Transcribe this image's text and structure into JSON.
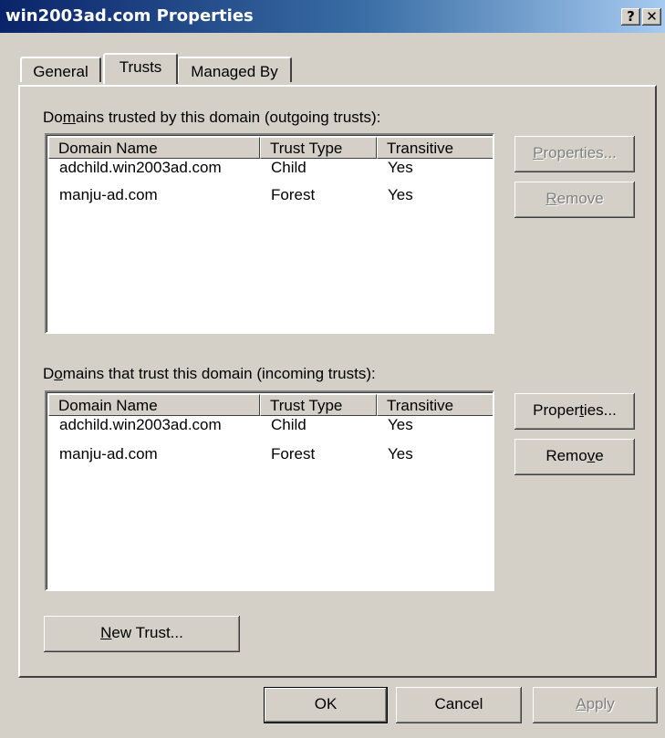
{
  "window": {
    "title": "win2003ad.com Properties",
    "help_button": "?",
    "close_button": "✕"
  },
  "tabs": [
    {
      "label": "General"
    },
    {
      "label": "Trusts"
    },
    {
      "label": "Managed By"
    }
  ],
  "outgoing": {
    "label_pre": "Do",
    "label_accel": "m",
    "label_post": "ains trusted by this domain (outgoing trusts):",
    "columns": [
      "Domain Name",
      "Trust Type",
      "Transitive"
    ],
    "rows": [
      [
        "adchild.win2003ad.com",
        "Child",
        "Yes"
      ],
      [
        "manju-ad.com",
        "Forest",
        "Yes"
      ]
    ],
    "properties_button": {
      "accel": "P",
      "rest": "roperties..."
    },
    "remove_button": {
      "accel": "R",
      "rest": "emove"
    }
  },
  "incoming": {
    "label_pre": "D",
    "label_accel": "o",
    "label_post": "mains that trust this domain (incoming trusts):",
    "columns": [
      "Domain Name",
      "Trust Type",
      "Transitive"
    ],
    "rows": [
      [
        "adchild.win2003ad.com",
        "Child",
        "Yes"
      ],
      [
        "manju-ad.com",
        "Forest",
        "Yes"
      ]
    ],
    "properties_button": {
      "pre": "Proper",
      "accel": "t",
      "post": "ies..."
    },
    "remove_button": {
      "pre": "Remo",
      "accel": "v",
      "post": "e"
    }
  },
  "new_trust_button": {
    "accel": "N",
    "rest": "ew Trust..."
  },
  "footer": {
    "ok": "OK",
    "cancel": "Cancel",
    "apply_accel": "A",
    "apply_rest": "pply"
  }
}
